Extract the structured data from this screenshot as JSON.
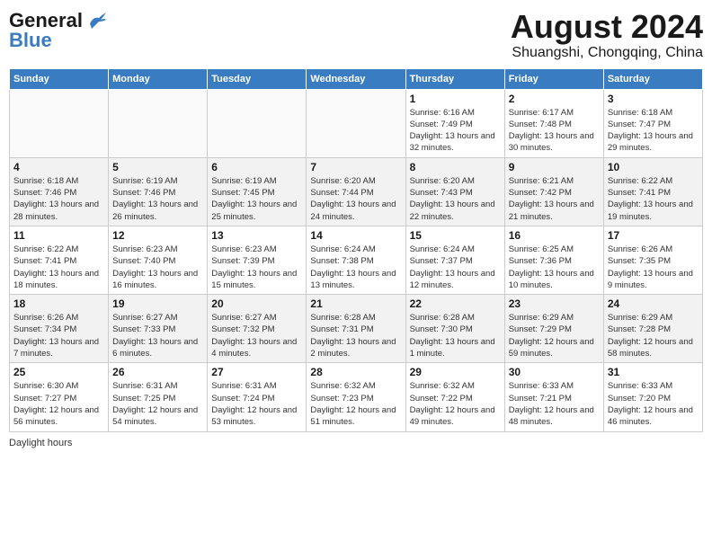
{
  "header": {
    "logo_general": "General",
    "logo_blue": "Blue",
    "title": "August 2024",
    "subtitle": "Shuangshi, Chongqing, China"
  },
  "days_of_week": [
    "Sunday",
    "Monday",
    "Tuesday",
    "Wednesday",
    "Thursday",
    "Friday",
    "Saturday"
  ],
  "weeks": [
    [
      {
        "day": "",
        "info": ""
      },
      {
        "day": "",
        "info": ""
      },
      {
        "day": "",
        "info": ""
      },
      {
        "day": "",
        "info": ""
      },
      {
        "day": "1",
        "info": "Sunrise: 6:16 AM\nSunset: 7:49 PM\nDaylight: 13 hours and 32 minutes."
      },
      {
        "day": "2",
        "info": "Sunrise: 6:17 AM\nSunset: 7:48 PM\nDaylight: 13 hours and 30 minutes."
      },
      {
        "day": "3",
        "info": "Sunrise: 6:18 AM\nSunset: 7:47 PM\nDaylight: 13 hours and 29 minutes."
      }
    ],
    [
      {
        "day": "4",
        "info": "Sunrise: 6:18 AM\nSunset: 7:46 PM\nDaylight: 13 hours and 28 minutes."
      },
      {
        "day": "5",
        "info": "Sunrise: 6:19 AM\nSunset: 7:46 PM\nDaylight: 13 hours and 26 minutes."
      },
      {
        "day": "6",
        "info": "Sunrise: 6:19 AM\nSunset: 7:45 PM\nDaylight: 13 hours and 25 minutes."
      },
      {
        "day": "7",
        "info": "Sunrise: 6:20 AM\nSunset: 7:44 PM\nDaylight: 13 hours and 24 minutes."
      },
      {
        "day": "8",
        "info": "Sunrise: 6:20 AM\nSunset: 7:43 PM\nDaylight: 13 hours and 22 minutes."
      },
      {
        "day": "9",
        "info": "Sunrise: 6:21 AM\nSunset: 7:42 PM\nDaylight: 13 hours and 21 minutes."
      },
      {
        "day": "10",
        "info": "Sunrise: 6:22 AM\nSunset: 7:41 PM\nDaylight: 13 hours and 19 minutes."
      }
    ],
    [
      {
        "day": "11",
        "info": "Sunrise: 6:22 AM\nSunset: 7:41 PM\nDaylight: 13 hours and 18 minutes."
      },
      {
        "day": "12",
        "info": "Sunrise: 6:23 AM\nSunset: 7:40 PM\nDaylight: 13 hours and 16 minutes."
      },
      {
        "day": "13",
        "info": "Sunrise: 6:23 AM\nSunset: 7:39 PM\nDaylight: 13 hours and 15 minutes."
      },
      {
        "day": "14",
        "info": "Sunrise: 6:24 AM\nSunset: 7:38 PM\nDaylight: 13 hours and 13 minutes."
      },
      {
        "day": "15",
        "info": "Sunrise: 6:24 AM\nSunset: 7:37 PM\nDaylight: 13 hours and 12 minutes."
      },
      {
        "day": "16",
        "info": "Sunrise: 6:25 AM\nSunset: 7:36 PM\nDaylight: 13 hours and 10 minutes."
      },
      {
        "day": "17",
        "info": "Sunrise: 6:26 AM\nSunset: 7:35 PM\nDaylight: 13 hours and 9 minutes."
      }
    ],
    [
      {
        "day": "18",
        "info": "Sunrise: 6:26 AM\nSunset: 7:34 PM\nDaylight: 13 hours and 7 minutes."
      },
      {
        "day": "19",
        "info": "Sunrise: 6:27 AM\nSunset: 7:33 PM\nDaylight: 13 hours and 6 minutes."
      },
      {
        "day": "20",
        "info": "Sunrise: 6:27 AM\nSunset: 7:32 PM\nDaylight: 13 hours and 4 minutes."
      },
      {
        "day": "21",
        "info": "Sunrise: 6:28 AM\nSunset: 7:31 PM\nDaylight: 13 hours and 2 minutes."
      },
      {
        "day": "22",
        "info": "Sunrise: 6:28 AM\nSunset: 7:30 PM\nDaylight: 13 hours and 1 minute."
      },
      {
        "day": "23",
        "info": "Sunrise: 6:29 AM\nSunset: 7:29 PM\nDaylight: 12 hours and 59 minutes."
      },
      {
        "day": "24",
        "info": "Sunrise: 6:29 AM\nSunset: 7:28 PM\nDaylight: 12 hours and 58 minutes."
      }
    ],
    [
      {
        "day": "25",
        "info": "Sunrise: 6:30 AM\nSunset: 7:27 PM\nDaylight: 12 hours and 56 minutes."
      },
      {
        "day": "26",
        "info": "Sunrise: 6:31 AM\nSunset: 7:25 PM\nDaylight: 12 hours and 54 minutes."
      },
      {
        "day": "27",
        "info": "Sunrise: 6:31 AM\nSunset: 7:24 PM\nDaylight: 12 hours and 53 minutes."
      },
      {
        "day": "28",
        "info": "Sunrise: 6:32 AM\nSunset: 7:23 PM\nDaylight: 12 hours and 51 minutes."
      },
      {
        "day": "29",
        "info": "Sunrise: 6:32 AM\nSunset: 7:22 PM\nDaylight: 12 hours and 49 minutes."
      },
      {
        "day": "30",
        "info": "Sunrise: 6:33 AM\nSunset: 7:21 PM\nDaylight: 12 hours and 48 minutes."
      },
      {
        "day": "31",
        "info": "Sunrise: 6:33 AM\nSunset: 7:20 PM\nDaylight: 12 hours and 46 minutes."
      }
    ]
  ],
  "footer": {
    "label": "Daylight hours"
  }
}
